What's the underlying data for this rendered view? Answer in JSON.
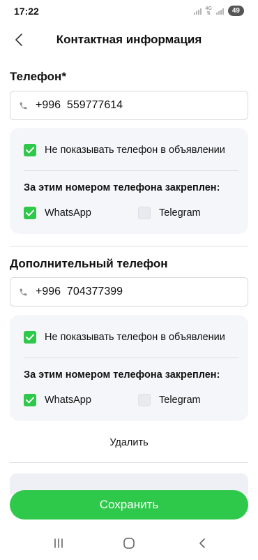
{
  "status_bar": {
    "time": "17:22",
    "network": "4G",
    "battery": "49"
  },
  "header": {
    "title": "Контактная информация"
  },
  "phone": {
    "label": "Телефон*",
    "value": "+996  559777614",
    "hide_label": "Не показывать телефон в объявлении",
    "hide_checked": true,
    "linked_label": "За этим номером телефона закреплен:",
    "whatsapp_label": "WhatsApp",
    "whatsapp_checked": true,
    "telegram_label": "Telegram",
    "telegram_checked": false
  },
  "extra_phone": {
    "label": "Дополнительный телефон",
    "value": "+996  704377399",
    "hide_label": "Не показывать телефон в объявлении",
    "hide_checked": true,
    "linked_label": "За этим номером телефона закреплен:",
    "whatsapp_label": "WhatsApp",
    "whatsapp_checked": true,
    "telegram_label": "Telegram",
    "telegram_checked": false,
    "delete_label": "Удалить"
  },
  "footer": {
    "save_label": "Сохранить"
  },
  "colors": {
    "accent": "#2ec84a",
    "card_bg": "#f5f6fa",
    "border": "#d8dadf"
  },
  "icons": [
    "back-arrow-icon",
    "phone-icon",
    "checkbox-checked-icon",
    "checkbox-empty-icon",
    "recent-apps-icon",
    "home-icon",
    "back-icon"
  ]
}
